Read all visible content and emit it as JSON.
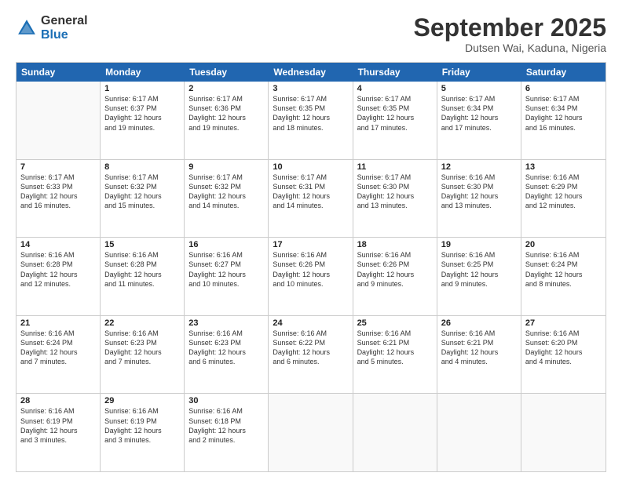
{
  "logo": {
    "general": "General",
    "blue": "Blue"
  },
  "title": "September 2025",
  "location": "Dutsen Wai, Kaduna, Nigeria",
  "header_days": [
    "Sunday",
    "Monday",
    "Tuesday",
    "Wednesday",
    "Thursday",
    "Friday",
    "Saturday"
  ],
  "weeks": [
    [
      {
        "day": "",
        "info": ""
      },
      {
        "day": "1",
        "info": "Sunrise: 6:17 AM\nSunset: 6:37 PM\nDaylight: 12 hours\nand 19 minutes."
      },
      {
        "day": "2",
        "info": "Sunrise: 6:17 AM\nSunset: 6:36 PM\nDaylight: 12 hours\nand 19 minutes."
      },
      {
        "day": "3",
        "info": "Sunrise: 6:17 AM\nSunset: 6:35 PM\nDaylight: 12 hours\nand 18 minutes."
      },
      {
        "day": "4",
        "info": "Sunrise: 6:17 AM\nSunset: 6:35 PM\nDaylight: 12 hours\nand 17 minutes."
      },
      {
        "day": "5",
        "info": "Sunrise: 6:17 AM\nSunset: 6:34 PM\nDaylight: 12 hours\nand 17 minutes."
      },
      {
        "day": "6",
        "info": "Sunrise: 6:17 AM\nSunset: 6:34 PM\nDaylight: 12 hours\nand 16 minutes."
      }
    ],
    [
      {
        "day": "7",
        "info": "Sunrise: 6:17 AM\nSunset: 6:33 PM\nDaylight: 12 hours\nand 16 minutes."
      },
      {
        "day": "8",
        "info": "Sunrise: 6:17 AM\nSunset: 6:32 PM\nDaylight: 12 hours\nand 15 minutes."
      },
      {
        "day": "9",
        "info": "Sunrise: 6:17 AM\nSunset: 6:32 PM\nDaylight: 12 hours\nand 14 minutes."
      },
      {
        "day": "10",
        "info": "Sunrise: 6:17 AM\nSunset: 6:31 PM\nDaylight: 12 hours\nand 14 minutes."
      },
      {
        "day": "11",
        "info": "Sunrise: 6:17 AM\nSunset: 6:30 PM\nDaylight: 12 hours\nand 13 minutes."
      },
      {
        "day": "12",
        "info": "Sunrise: 6:16 AM\nSunset: 6:30 PM\nDaylight: 12 hours\nand 13 minutes."
      },
      {
        "day": "13",
        "info": "Sunrise: 6:16 AM\nSunset: 6:29 PM\nDaylight: 12 hours\nand 12 minutes."
      }
    ],
    [
      {
        "day": "14",
        "info": "Sunrise: 6:16 AM\nSunset: 6:28 PM\nDaylight: 12 hours\nand 12 minutes."
      },
      {
        "day": "15",
        "info": "Sunrise: 6:16 AM\nSunset: 6:28 PM\nDaylight: 12 hours\nand 11 minutes."
      },
      {
        "day": "16",
        "info": "Sunrise: 6:16 AM\nSunset: 6:27 PM\nDaylight: 12 hours\nand 10 minutes."
      },
      {
        "day": "17",
        "info": "Sunrise: 6:16 AM\nSunset: 6:26 PM\nDaylight: 12 hours\nand 10 minutes."
      },
      {
        "day": "18",
        "info": "Sunrise: 6:16 AM\nSunset: 6:26 PM\nDaylight: 12 hours\nand 9 minutes."
      },
      {
        "day": "19",
        "info": "Sunrise: 6:16 AM\nSunset: 6:25 PM\nDaylight: 12 hours\nand 9 minutes."
      },
      {
        "day": "20",
        "info": "Sunrise: 6:16 AM\nSunset: 6:24 PM\nDaylight: 12 hours\nand 8 minutes."
      }
    ],
    [
      {
        "day": "21",
        "info": "Sunrise: 6:16 AM\nSunset: 6:24 PM\nDaylight: 12 hours\nand 7 minutes."
      },
      {
        "day": "22",
        "info": "Sunrise: 6:16 AM\nSunset: 6:23 PM\nDaylight: 12 hours\nand 7 minutes."
      },
      {
        "day": "23",
        "info": "Sunrise: 6:16 AM\nSunset: 6:23 PM\nDaylight: 12 hours\nand 6 minutes."
      },
      {
        "day": "24",
        "info": "Sunrise: 6:16 AM\nSunset: 6:22 PM\nDaylight: 12 hours\nand 6 minutes."
      },
      {
        "day": "25",
        "info": "Sunrise: 6:16 AM\nSunset: 6:21 PM\nDaylight: 12 hours\nand 5 minutes."
      },
      {
        "day": "26",
        "info": "Sunrise: 6:16 AM\nSunset: 6:21 PM\nDaylight: 12 hours\nand 4 minutes."
      },
      {
        "day": "27",
        "info": "Sunrise: 6:16 AM\nSunset: 6:20 PM\nDaylight: 12 hours\nand 4 minutes."
      }
    ],
    [
      {
        "day": "28",
        "info": "Sunrise: 6:16 AM\nSunset: 6:19 PM\nDaylight: 12 hours\nand 3 minutes."
      },
      {
        "day": "29",
        "info": "Sunrise: 6:16 AM\nSunset: 6:19 PM\nDaylight: 12 hours\nand 3 minutes."
      },
      {
        "day": "30",
        "info": "Sunrise: 6:16 AM\nSunset: 6:18 PM\nDaylight: 12 hours\nand 2 minutes."
      },
      {
        "day": "",
        "info": ""
      },
      {
        "day": "",
        "info": ""
      },
      {
        "day": "",
        "info": ""
      },
      {
        "day": "",
        "info": ""
      }
    ]
  ]
}
